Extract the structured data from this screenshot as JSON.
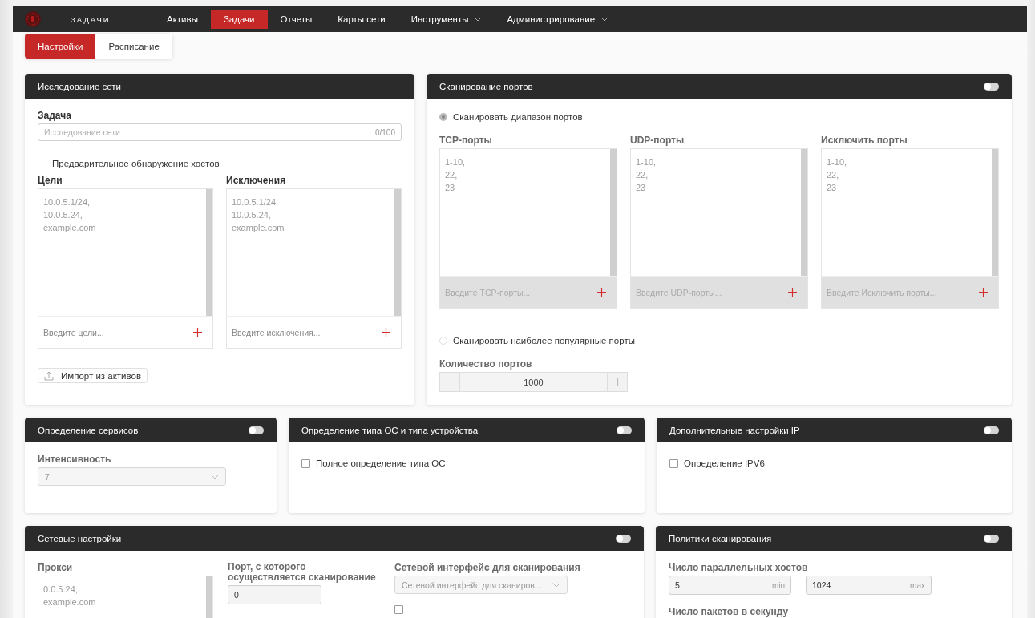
{
  "app": {
    "title": "ЗАДАЧИ"
  },
  "nav": [
    {
      "label": "Активы",
      "selected": false,
      "has_menu": false
    },
    {
      "label": "Задачи",
      "selected": true,
      "has_menu": false
    },
    {
      "label": "Отчеты",
      "selected": false,
      "has_menu": false
    },
    {
      "label": "Карты сети",
      "selected": false,
      "has_menu": false
    },
    {
      "label": "Инструменты",
      "selected": false,
      "has_menu": true
    },
    {
      "label": "Администрирование",
      "selected": false,
      "has_menu": true
    }
  ],
  "subtabs": [
    {
      "label": "Настройки",
      "selected": true
    },
    {
      "label": "Расписание",
      "selected": false
    }
  ],
  "network_discovery": {
    "title": "Исследование сети",
    "task": {
      "label": "Задача",
      "placeholder": "Исследование сети",
      "counter": "0/100"
    },
    "host_discovery": {
      "label": "Предварительное обнаружение хостов",
      "checked": false
    },
    "lists": [
      {
        "label": "Цели",
        "placeholder": "10.0.5.1/24,\n10.0.5.24,\nexample.com",
        "input_placeholder": "Введите цели...",
        "disabled": false
      },
      {
        "label": "Исключения",
        "placeholder": "10.0.5.1/24,\n10.0.5.24,\nexample.com",
        "input_placeholder": "Введите исключения...",
        "disabled": false
      }
    ],
    "import_button": "Импорт из активов"
  },
  "port_scan": {
    "title": "Сканирование портов",
    "enabled": false,
    "modes": [
      {
        "label": "Сканировать диапазон портов",
        "selected": true
      },
      {
        "label": "Сканировать наиболее популярные порты",
        "selected": false
      }
    ],
    "lists": [
      {
        "label": "TCP-порты",
        "placeholder": "1-10,\n22,\n23",
        "input_placeholder": "Введите TCP-порты...",
        "disabled": true
      },
      {
        "label": "UDP-порты",
        "placeholder": "1-10,\n22,\n23",
        "input_placeholder": "Введите UDP-порты...",
        "disabled": true
      },
      {
        "label": "Исключить порты",
        "placeholder": "1-10,\n22,\n23",
        "input_placeholder": "Введите Исключить порты...",
        "disabled": true
      }
    ],
    "port_count": {
      "label": "Количество портов",
      "value": "1000"
    }
  },
  "services": {
    "title": "Определение сервисов",
    "enabled": false,
    "intensity": {
      "label": "Интенсивность",
      "value": "7"
    }
  },
  "os_detection": {
    "title": "Определение типа ОС и типа устройства",
    "enabled": false,
    "full_os": {
      "label": "Полное определение типа ОС",
      "checked": false
    }
  },
  "ip_settings": {
    "title": "Дополнительные настройки IP",
    "enabled": false,
    "ipv6": {
      "label": "Определение IPV6",
      "checked": false
    }
  },
  "network_settings": {
    "title": "Сетевые настройки",
    "enabled": false,
    "proxy": {
      "label": "Прокси",
      "placeholder": "0.0.5.24,\nexample.com"
    },
    "source_port": {
      "label": "Порт, с которого осуществляется сканирование",
      "value": "0"
    },
    "interface": {
      "label": "Сетевой интерфейс для сканирования",
      "placeholder": "Сетевой интерфейс для сканиров..."
    },
    "trace": {
      "checked": false
    }
  },
  "scan_policies": {
    "title": "Политики сканирования",
    "enabled": false,
    "parallel_hosts": {
      "label": "Число параллельных хостов",
      "min": {
        "value": "5",
        "suffix": "min"
      },
      "max": {
        "value": "1024",
        "suffix": "max"
      }
    },
    "packets_label": "Число пакетов в секунду"
  }
}
